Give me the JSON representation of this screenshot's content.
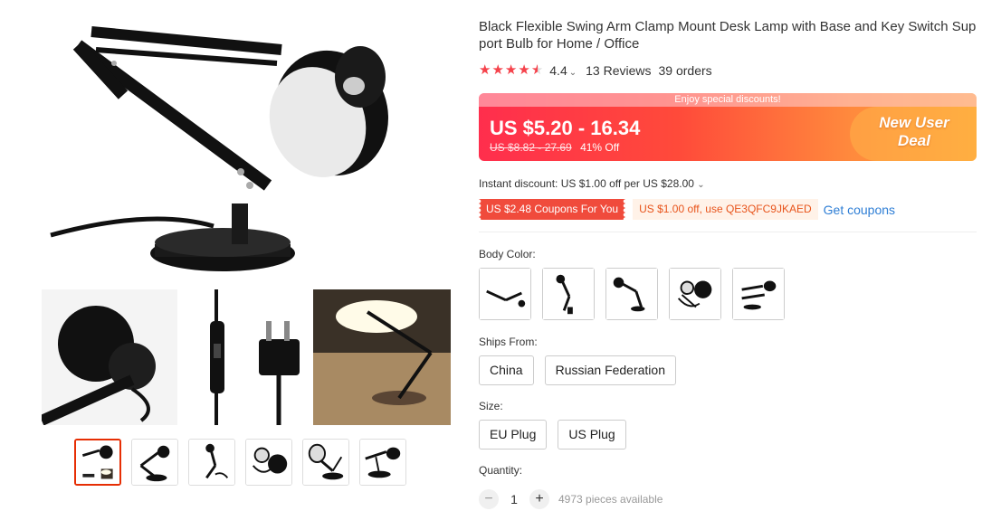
{
  "product": {
    "title": "Black Flexible Swing Arm Clamp Mount Desk Lamp with Base and Key Switch Support Bulb for Home / Office",
    "rating": "4.4",
    "reviews": "13 Reviews",
    "orders": "39 orders"
  },
  "price": {
    "banner": "Enjoy special discounts!",
    "current": "US $5.20 - 16.34",
    "original": "US $8.82 - 27.69",
    "discount": "41% Off",
    "new_user_line1": "New User",
    "new_user_line2": "Deal"
  },
  "discounts": {
    "instant": "Instant discount: US $1.00 off per US $28.00",
    "coupon_red": "US $2.48 Coupons For You",
    "coupon_code": "US $1.00 off, use QE3QFC9JKAED",
    "get_coupons": "Get coupons"
  },
  "options": {
    "body_color_label": "Body Color:",
    "ships_from_label": "Ships From:",
    "ships_from": [
      "China",
      "Russian Federation"
    ],
    "size_label": "Size:",
    "sizes": [
      "EU Plug",
      "US Plug"
    ],
    "quantity_label": "Quantity:",
    "quantity": "1",
    "available": "4973 pieces available"
  },
  "colors": {
    "accent": "#f5424b",
    "link": "#2e7ed5"
  }
}
